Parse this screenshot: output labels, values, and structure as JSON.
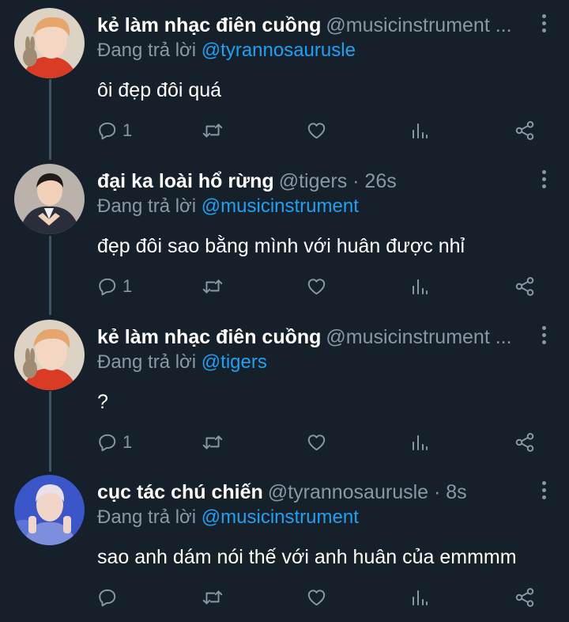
{
  "tweets": [
    {
      "name": "kẻ làm nhạc điên cuồng",
      "handle": "@musicinstrument ...",
      "reply_prefix": "Đang trả lời",
      "reply_to": "@tyrannosaurusle",
      "text": "ôi đẹp đôi quá",
      "reply_count": "1",
      "avatar": "orange-hair-person-with-rabbit"
    },
    {
      "name": "đại ka loài hổ rừng",
      "handle": "@tigers · 26s",
      "reply_prefix": "Đang trả lời",
      "reply_to": "@musicinstrument",
      "text": "đẹp đôi sao bằng mình với huân được nhỉ",
      "reply_count": "1",
      "avatar": "person-in-suit-heart-hands"
    },
    {
      "name": "kẻ làm nhạc điên cuồng",
      "handle": "@musicinstrument ...",
      "reply_prefix": "Đang trả lời",
      "reply_to": "@tigers",
      "text": "?",
      "reply_count": "1",
      "avatar": "orange-hair-person-with-rabbit"
    },
    {
      "name": "cục tác chú chiến",
      "handle": "@tyrannosaurusle · 8s",
      "reply_prefix": "Đang trả lời",
      "reply_to": "@musicinstrument",
      "text": "sao anh dám nói thế với anh huân của emmmm",
      "reply_count": "",
      "avatar": "person-blue-background"
    }
  ],
  "colors": {
    "background": "#15202b",
    "secondary_text": "#8899a6",
    "mention": "#1da1f2",
    "thread_line": "#3d5466"
  },
  "icons": [
    "reply-icon",
    "retweet-icon",
    "like-icon",
    "stats-icon",
    "share-icon",
    "more-icon"
  ]
}
